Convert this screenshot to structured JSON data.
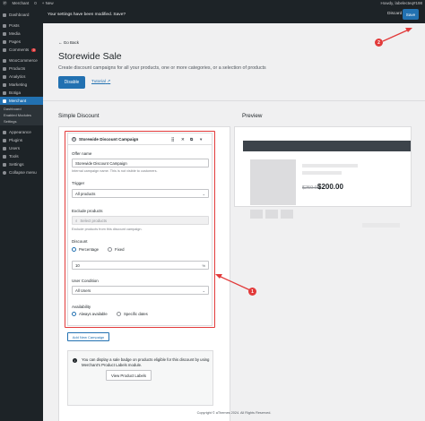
{
  "admin_bar": {
    "site_name": "Merchant",
    "comments": "0",
    "new": "+ New",
    "greeting": "Howdy, labelecteq#198"
  },
  "notice": {
    "text": "Your settings have been modified. Save?",
    "discard": "Discard",
    "save": "Save"
  },
  "sidebar": {
    "items": [
      {
        "label": "Dashboard",
        "icon": "dashboard-icon"
      },
      {
        "label": "Posts",
        "icon": "pin-icon"
      },
      {
        "label": "Media",
        "icon": "media-icon"
      },
      {
        "label": "Pages",
        "icon": "page-icon"
      },
      {
        "label": "Comments",
        "icon": "comment-icon",
        "badge": "0"
      },
      {
        "label": "WooCommerce",
        "icon": "woo-icon"
      },
      {
        "label": "Products",
        "icon": "box-icon"
      },
      {
        "label": "Analytics",
        "icon": "chart-icon"
      },
      {
        "label": "Marketing",
        "icon": "megaphone-icon"
      },
      {
        "label": "Botiga",
        "icon": "theme-icon"
      },
      {
        "label": "Merchant",
        "icon": "merchant-icon"
      }
    ],
    "submenu": [
      "Dashboard",
      "Enabled Modules",
      "Settings"
    ],
    "items2": [
      {
        "label": "Appearance",
        "icon": "brush-icon"
      },
      {
        "label": "Plugins",
        "icon": "plugin-icon"
      },
      {
        "label": "Users",
        "icon": "user-icon"
      },
      {
        "label": "Tools",
        "icon": "wrench-icon"
      },
      {
        "label": "Settings",
        "icon": "settings-icon"
      },
      {
        "label": "Collapse menu",
        "icon": "collapse-icon"
      }
    ]
  },
  "page": {
    "go_back": "← Go Back",
    "title": "Storewide Sale",
    "description": "Create discount campaigns for all your products, one or more categories, or a selection of products",
    "enable": "Disable",
    "tutorial": "Tutorial"
  },
  "simple_discount": {
    "section_title": "Simple Discount",
    "card_title": "Storewide Discount Campaign",
    "card_number": "1",
    "offer_name_label": "Offer name",
    "offer_name_value": "Storewide Discount Campaign",
    "offer_name_help": "Internal campaign name. This is not visible to customers.",
    "trigger_label": "Trigger",
    "trigger_value": "All products",
    "exclude_label": "Exclude products",
    "exclude_placeholder": "Select products",
    "exclude_help": "Exclude products from this discount campaign.",
    "discount_label": "Discount",
    "discount_opt1": "Percentage",
    "discount_opt2": "Fixed",
    "discount_value": "10",
    "discount_unit": "%",
    "user_condition_label": "User Condition",
    "user_condition_value": "All Users",
    "availability_label": "Availability",
    "avail_opt1": "Always available",
    "avail_opt2": "Specific dates",
    "add_campaign": "Add New Campaign",
    "info_text": "You can display a sale badge on products eligible for this discount by using Merchant's Product Labels module.",
    "info_button": "View Product Labels"
  },
  "preview": {
    "section_title": "Preview",
    "old_price": "$250.00",
    "new_price": "$200.00"
  },
  "annotations": [
    "1",
    "2"
  ],
  "footer": "Copyright © aThemes 2024. All Rights Reserved.",
  "colors": {
    "accent": "#2271b1",
    "annotation": "#e23a3a",
    "admin": "#1d2327"
  }
}
